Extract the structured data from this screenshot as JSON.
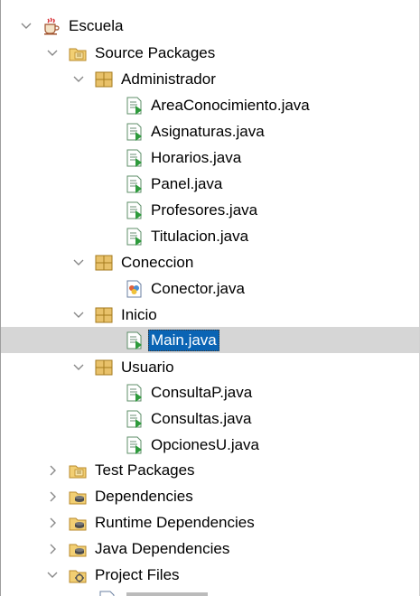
{
  "tree": {
    "project": {
      "label": "Escuela",
      "icon": "coffee-cup-project-icon"
    },
    "source_packages": {
      "label": "Source Packages",
      "icon": "source-folder-icon"
    },
    "packages": [
      {
        "label": "Administrador",
        "icon": "package-icon",
        "files": [
          "AreaConocimiento.java",
          "Asignaturas.java",
          "Horarios.java",
          "Panel.java",
          "Profesores.java",
          "Titulacion.java"
        ]
      },
      {
        "label": "Coneccion",
        "icon": "package-icon",
        "files": [
          "Conector.java"
        ]
      },
      {
        "label": "Inicio",
        "icon": "package-icon",
        "files": [
          "Main.java"
        ]
      },
      {
        "label": "Usuario",
        "icon": "package-icon",
        "files": [
          "ConsultaP.java",
          "Consultas.java",
          "OpcionesU.java"
        ]
      }
    ],
    "selected_file": "Main.java",
    "other_nodes": [
      {
        "label": "Test Packages",
        "icon": "test-folder-icon"
      },
      {
        "label": "Dependencies",
        "icon": "jar-folder-icon"
      },
      {
        "label": "Runtime Dependencies",
        "icon": "jar-folder-icon"
      },
      {
        "label": "Java Dependencies",
        "icon": "jar-folder-icon"
      },
      {
        "label": "Project Files",
        "icon": "project-files-folder-icon"
      }
    ]
  },
  "colors": {
    "selection_bg": "#0a64b4",
    "row_highlight": "#d6d6d6",
    "package_fill": "#e8c16a",
    "folder_fill": "#f2cf73",
    "java_file_green": "#2e9b3c"
  }
}
